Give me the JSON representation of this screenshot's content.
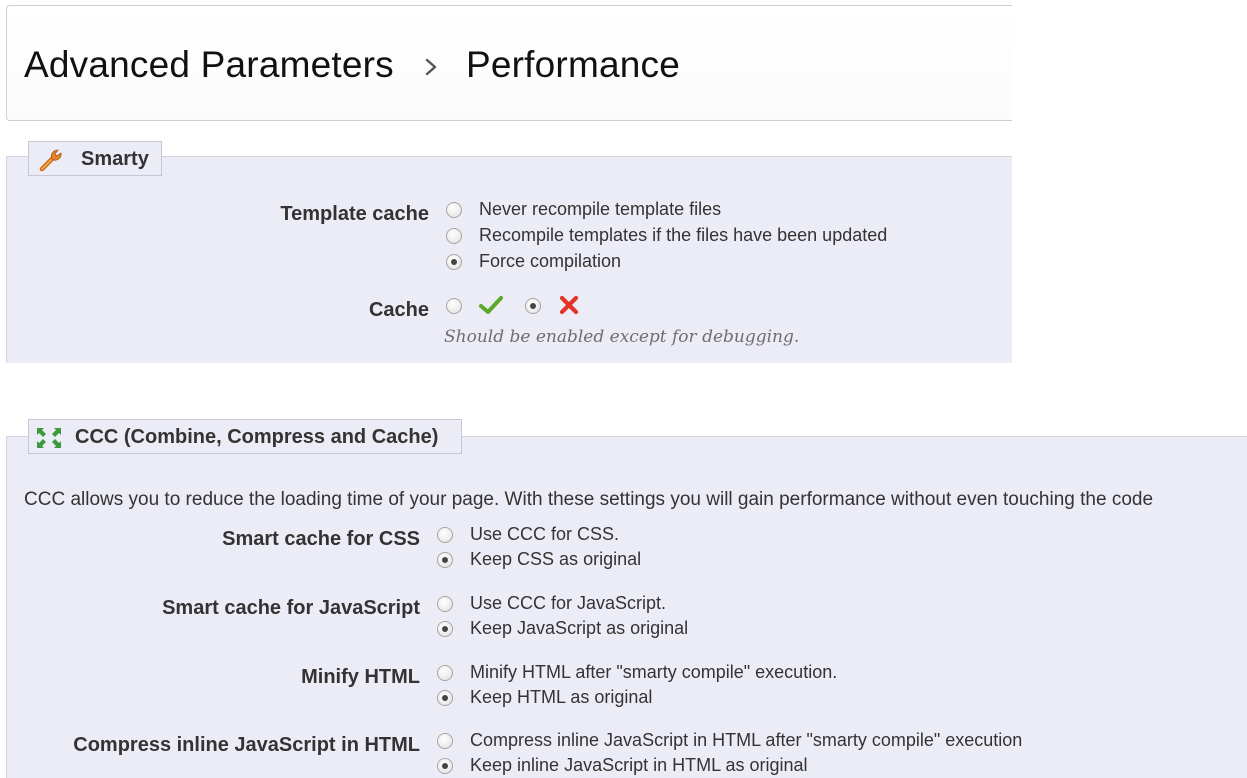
{
  "breadcrumb": {
    "parent": "Advanced Parameters",
    "separator_icon": "chevron-right-icon",
    "current": "Performance"
  },
  "smarty": {
    "legend": "Smarty",
    "legend_icon": "wrench-icon",
    "template_cache": {
      "label": "Template cache",
      "options": [
        {
          "label": "Never recompile template files",
          "checked": false
        },
        {
          "label": "Recompile templates if the files have been updated",
          "checked": false
        },
        {
          "label": "Force compilation",
          "checked": true
        }
      ]
    },
    "cache": {
      "label": "Cache",
      "yes_icon": "check-icon",
      "no_icon": "cross-icon",
      "selected": "no",
      "hint": "Should be enabled except for debugging."
    }
  },
  "ccc": {
    "legend": "CCC (Combine, Compress and Cache)",
    "legend_icon": "compress-arrows-icon",
    "description": "CCC allows you to reduce the loading time of your page. With these settings you will gain performance without even touching the code",
    "fields": [
      {
        "label": "Smart cache for CSS",
        "options": [
          {
            "label": "Use CCC for CSS.",
            "checked": false
          },
          {
            "label": "Keep CSS as original",
            "checked": true
          }
        ]
      },
      {
        "label": "Smart cache for JavaScript",
        "options": [
          {
            "label": "Use CCC for JavaScript.",
            "checked": false
          },
          {
            "label": "Keep JavaScript as original",
            "checked": true
          }
        ]
      },
      {
        "label": "Minify HTML",
        "options": [
          {
            "label": "Minify HTML after \"smarty compile\" execution.",
            "checked": false
          },
          {
            "label": "Keep HTML as original",
            "checked": true
          }
        ]
      },
      {
        "label": "Compress inline JavaScript in HTML",
        "options": [
          {
            "label": "Compress inline JavaScript in HTML after \"smarty compile\" execution",
            "checked": false
          },
          {
            "label": "Keep inline JavaScript in HTML as original",
            "checked": true
          }
        ]
      }
    ]
  },
  "colors": {
    "panel_bg": "#ececf6",
    "check_green": "#5ba82a",
    "cross_red": "#e3342a",
    "wrench_orange": "#e0862a",
    "ccc_green": "#3c9a3c"
  }
}
